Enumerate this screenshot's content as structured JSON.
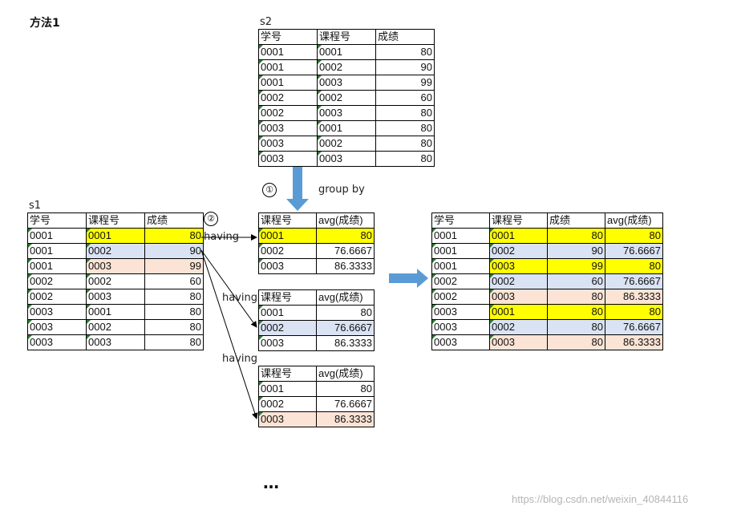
{
  "heading": "方法1",
  "s2": {
    "label": "s2",
    "headers": [
      "学号",
      "课程号",
      "成绩"
    ],
    "rows": [
      [
        "0001",
        "0001",
        "80"
      ],
      [
        "0001",
        "0002",
        "90"
      ],
      [
        "0001",
        "0003",
        "99"
      ],
      [
        "0002",
        "0002",
        "60"
      ],
      [
        "0002",
        "0003",
        "80"
      ],
      [
        "0003",
        "0001",
        "80"
      ],
      [
        "0003",
        "0002",
        "80"
      ],
      [
        "0003",
        "0003",
        "80"
      ]
    ]
  },
  "s1": {
    "label": "s1",
    "headers": [
      "学号",
      "课程号",
      "成绩"
    ],
    "rows": [
      [
        "0001",
        "0001",
        "80"
      ],
      [
        "0001",
        "0002",
        "90"
      ],
      [
        "0001",
        "0003",
        "99"
      ],
      [
        "0002",
        "0002",
        "60"
      ],
      [
        "0002",
        "0003",
        "80"
      ],
      [
        "0003",
        "0001",
        "80"
      ],
      [
        "0003",
        "0002",
        "80"
      ],
      [
        "0003",
        "0003",
        "80"
      ]
    ]
  },
  "avg_tables": {
    "headers": [
      "课程号",
      "avg(成绩)"
    ],
    "rows": [
      [
        "0001",
        "80"
      ],
      [
        "0002",
        "76.6667"
      ],
      [
        "0003",
        "86.3333"
      ]
    ]
  },
  "result": {
    "headers": [
      "学号",
      "课程号",
      "成绩",
      "avg(成绩)"
    ],
    "rows": [
      [
        "0001",
        "0001",
        "80",
        "80"
      ],
      [
        "0001",
        "0002",
        "90",
        "76.6667"
      ],
      [
        "0001",
        "0003",
        "99",
        "80"
      ],
      [
        "0002",
        "0002",
        "60",
        "76.6667"
      ],
      [
        "0002",
        "0003",
        "80",
        "86.3333"
      ],
      [
        "0003",
        "0001",
        "80",
        "80"
      ],
      [
        "0003",
        "0002",
        "80",
        "76.6667"
      ],
      [
        "0003",
        "0003",
        "80",
        "86.3333"
      ]
    ]
  },
  "labels": {
    "step1": "①",
    "step2": "②",
    "group_by": "group by",
    "having": "having",
    "ellipsis": "…"
  },
  "watermark": "https://blog.csdn.net/weixin_40844116",
  "colors": {
    "yellow": "#ffff00",
    "blue": "#dae3f3",
    "peach": "#fbe4d5",
    "arrow": "#5b9bd5"
  }
}
